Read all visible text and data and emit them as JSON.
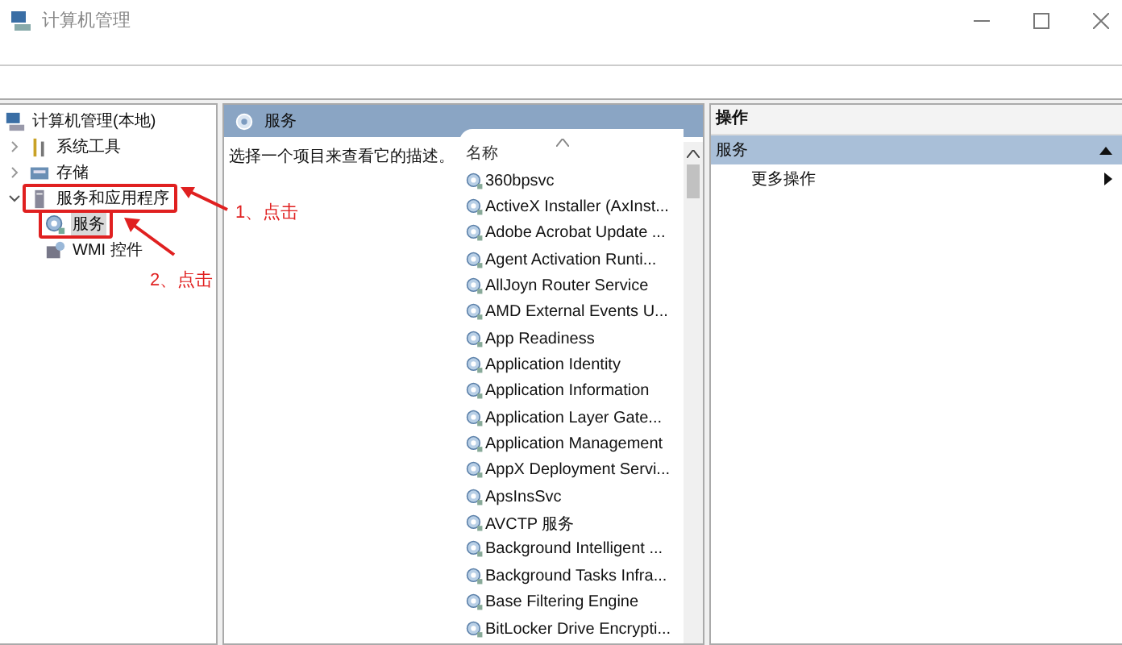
{
  "window": {
    "title": "计算机管理"
  },
  "tree": [
    {
      "label": "计算机管理(本地)",
      "kind": "computer",
      "children": [
        {
          "label": "系统工具",
          "kind": "tools",
          "expanded": false,
          "selected": false,
          "outlined": false
        },
        {
          "label": "存储",
          "kind": "storage",
          "expanded": false,
          "selected": false,
          "outlined": false
        },
        {
          "label": "服务和应用程序",
          "kind": "apps",
          "expanded": true,
          "selected": false,
          "outlined": true,
          "children": [
            {
              "label": "服务",
              "kind": "services",
              "selected": true,
              "outlined": true
            },
            {
              "label": "WMI 控件",
              "kind": "wmi",
              "selected": false,
              "outlined": false
            }
          ]
        }
      ]
    }
  ],
  "annotations": [
    "1、点击",
    "2、点击"
  ],
  "center": {
    "title": "服务",
    "description": "选择一个项目来查看它的描述。",
    "column": "名称",
    "services": [
      "360bpsvc",
      "ActiveX Installer (AxInst...",
      "Adobe Acrobat Update ...",
      "Agent Activation Runti...",
      "AllJoyn Router Service",
      "AMD External Events U...",
      "App Readiness",
      "Application Identity",
      "Application Information",
      "Application Layer Gate...",
      "Application Management",
      "AppX Deployment Servi...",
      "ApsInsSvc",
      "AVCTP 服务",
      "Background Intelligent ...",
      "Background Tasks Infra...",
      "Base Filtering Engine",
      "BitLocker Drive Encrypti..."
    ]
  },
  "actions": {
    "title": "操作",
    "section": "服务",
    "items": [
      "更多操作"
    ]
  }
}
